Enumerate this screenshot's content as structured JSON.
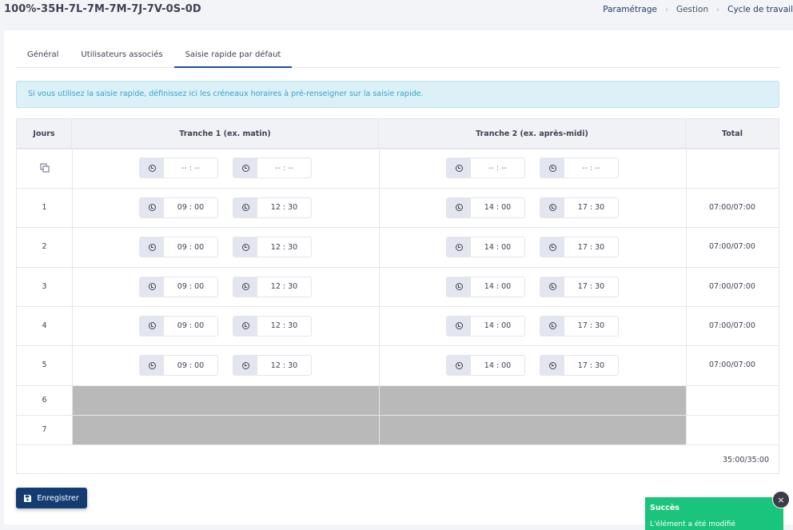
{
  "header": {
    "title": "100%-35H-7L-7M-7M-7J-7V-0S-0D",
    "breadcrumb": [
      "Paramétrage",
      "Gestion",
      "Cycle de travail"
    ]
  },
  "tabs": [
    {
      "label": "Général",
      "active": false
    },
    {
      "label": "Utilisateurs associés",
      "active": false
    },
    {
      "label": "Saisie rapide par défaut",
      "active": true
    }
  ],
  "alert": {
    "text": "Si vous utilisez la saisie rapide, définissez ici les créneaux horaires à pré-renseigner sur la saisie rapide."
  },
  "table": {
    "headers": {
      "days": "Jours",
      "slot1": "Tranche 1 (ex. matin)",
      "slot2": "Tranche 2 (ex. après-midi)",
      "total": "Total"
    },
    "template_row": {
      "icon": "copy-icon",
      "placeholder": "-- : --"
    },
    "rows": [
      {
        "day": "1",
        "t1_start": "09 : 00",
        "t1_end": "12 : 30",
        "t2_start": "14 : 00",
        "t2_end": "17 : 30",
        "total": "07:00/07:00"
      },
      {
        "day": "2",
        "t1_start": "09 : 00",
        "t1_end": "12 : 30",
        "t2_start": "14 : 00",
        "t2_end": "17 : 30",
        "total": "07:00/07:00"
      },
      {
        "day": "3",
        "t1_start": "09 : 00",
        "t1_end": "12 : 30",
        "t2_start": "14 : 00",
        "t2_end": "17 : 30",
        "total": "07:00/07:00"
      },
      {
        "day": "4",
        "t1_start": "09 : 00",
        "t1_end": "12 : 30",
        "t2_start": "14 : 00",
        "t2_end": "17 : 30",
        "total": "07:00/07:00"
      },
      {
        "day": "5",
        "t1_start": "09 : 00",
        "t1_end": "12 : 30",
        "t2_start": "14 : 00",
        "t2_end": "17 : 30",
        "total": "07:00/07:00"
      },
      {
        "day": "6"
      },
      {
        "day": "7"
      }
    ],
    "grand_total": "35:00/35:00"
  },
  "actions": {
    "save_label": "Enregistrer",
    "save_icon": "floppy-disk-icon"
  },
  "toast": {
    "title": "Succès",
    "message": "L'élément a été modifié",
    "color": "#1bc47d",
    "close_label": "×"
  },
  "colors": {
    "primary": "#133d72",
    "active_tab": "#1e4f9a",
    "alert_bg": "#dcf1f7",
    "alert_text": "#36a3c9",
    "disabled": "#b9b9b9"
  }
}
